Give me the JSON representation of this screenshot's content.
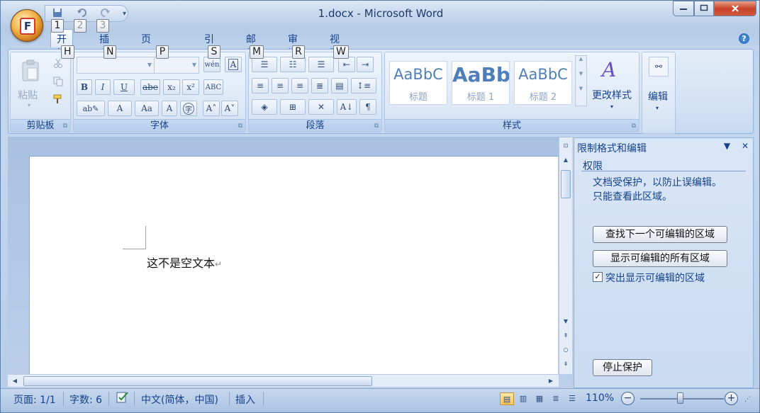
{
  "window": {
    "title": "1.docx - Microsoft Word",
    "minimize_icon": "minimize-icon",
    "maximize_icon": "maximize-icon",
    "close_icon": "close-icon"
  },
  "office_button": {
    "letter": "F"
  },
  "quick_access": {
    "keytips": [
      "1",
      "2",
      "3"
    ],
    "icons": [
      "save-icon",
      "undo-icon",
      "redo-icon",
      "customize-dropdown-icon"
    ]
  },
  "tabs": [
    {
      "label": "开始",
      "keytip": "H"
    },
    {
      "label": "插入",
      "keytip": "N"
    },
    {
      "label": "页面布局",
      "keytip": "P"
    },
    {
      "label": "引用",
      "keytip": "S"
    },
    {
      "label": "邮件",
      "keytip": "M"
    },
    {
      "label": "审阅",
      "keytip": "R"
    },
    {
      "label": "视图",
      "keytip": "W"
    }
  ],
  "ribbon": {
    "clipboard": {
      "label": "剪贴板",
      "paste_label": "粘贴"
    },
    "font": {
      "label": "字体",
      "buttons": [
        "B",
        "I",
        "U",
        "abe",
        "x₂",
        "x²",
        "A",
        "Aa",
        "A",
        "A˄",
        "A˅"
      ]
    },
    "paragraph": {
      "label": "段落"
    },
    "styles": {
      "label": "样式",
      "gallery": [
        {
          "sample": "AaBbC",
          "name": "标题"
        },
        {
          "sample": "AaBb",
          "name": "标题 1"
        },
        {
          "sample": "AaBbC",
          "name": "标题 2"
        }
      ],
      "change_styles": "更改样式"
    },
    "editing": {
      "label": "编辑"
    }
  },
  "document": {
    "body_text": "这不是空文本",
    "paragraph_mark": "↵"
  },
  "task_pane": {
    "title": "限制格式和编辑",
    "section": "权限",
    "message_line1": "文档受保护，以防止误编辑。",
    "message_line2": "只能查看此区域。",
    "find_next_button": "查找下一个可编辑的区域",
    "show_all_button": "显示可编辑的所有区域",
    "highlight_checkbox_label": "突出显示可编辑的区域",
    "highlight_checked": true,
    "stop_protection_button": "停止保护"
  },
  "status_bar": {
    "page": "页面: 1/1",
    "word_count": "字数: 6",
    "language": "中文(简体，中国)",
    "mode": "插入",
    "zoom": "110%"
  },
  "colors": {
    "ribbon_text": "#15428b",
    "close_button": "#c8432a",
    "accent_active_view": "#f6c45a"
  }
}
